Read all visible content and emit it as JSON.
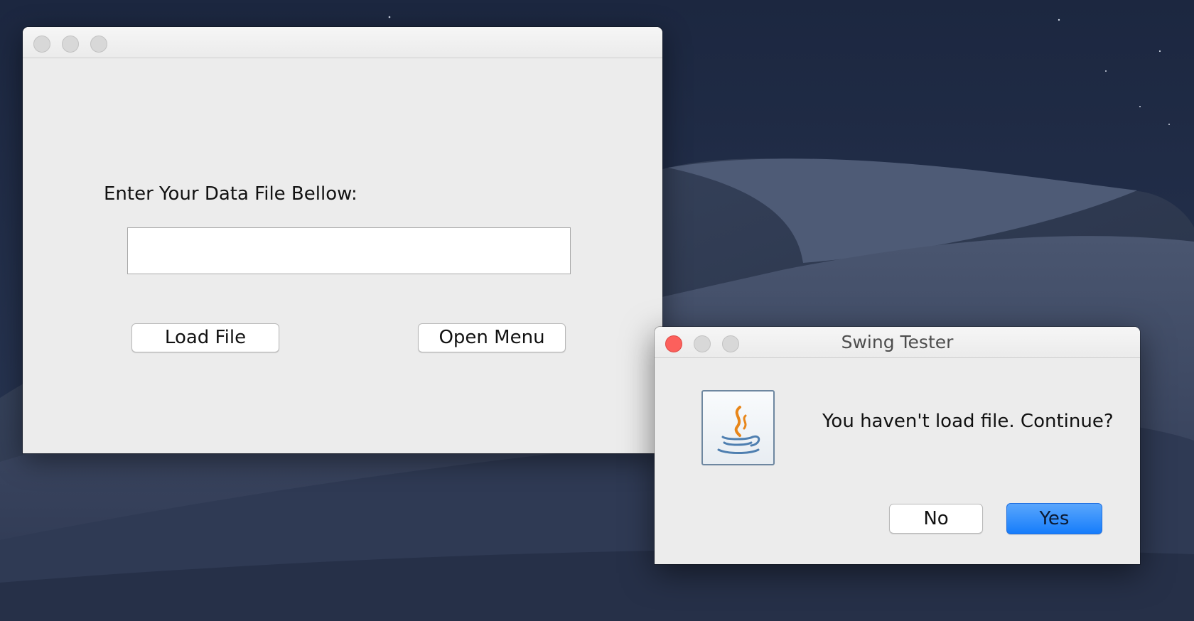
{
  "main_window": {
    "title": "",
    "prompt_label": "Enter Your Data File Bellow:",
    "file_input": {
      "value": "",
      "placeholder": ""
    },
    "load_button_label": "Load File",
    "open_menu_button_label": "Open Menu"
  },
  "dialog": {
    "title": "Swing Tester",
    "message": "You haven't load file. Continue?",
    "icon": "java-icon",
    "no_button_label": "No",
    "yes_button_label": "Yes",
    "default_button": "Yes"
  },
  "colors": {
    "desktop": "#283448",
    "window_bg": "#ececec",
    "close_button": "#fc605c",
    "default_button": "#1d80fb"
  }
}
